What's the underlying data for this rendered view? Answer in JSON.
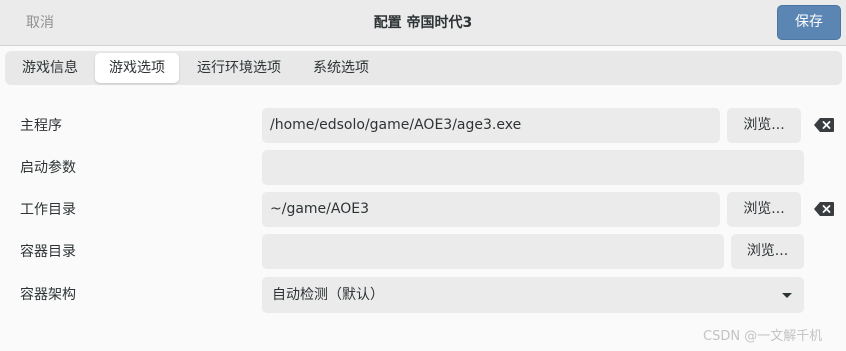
{
  "header": {
    "cancel_label": "取消",
    "title": "配置 帝国时代3",
    "save_label": "保存"
  },
  "tabs": [
    {
      "label": "游戏信息",
      "active": false
    },
    {
      "label": "游戏选项",
      "active": true
    },
    {
      "label": "运行环境选项",
      "active": false
    },
    {
      "label": "系统选项",
      "active": false
    }
  ],
  "form": {
    "main_program": {
      "label": "主程序",
      "value": "/home/edsolo/game/AOE3/age3.exe",
      "browse_label": "浏览..."
    },
    "launch_args": {
      "label": "启动参数",
      "value": ""
    },
    "working_dir": {
      "label": "工作目录",
      "value": "~/game/AOE3",
      "browse_label": "浏览..."
    },
    "container_dir": {
      "label": "容器目录",
      "value": "",
      "browse_label": "浏览..."
    },
    "container_arch": {
      "label": "容器架构",
      "value": "自动检测（默认）"
    }
  },
  "watermark": "CSDN @一文解千机",
  "colors": {
    "accent": "#5b86b4",
    "field_bg": "#ebebeb",
    "background": "#fafafa"
  }
}
